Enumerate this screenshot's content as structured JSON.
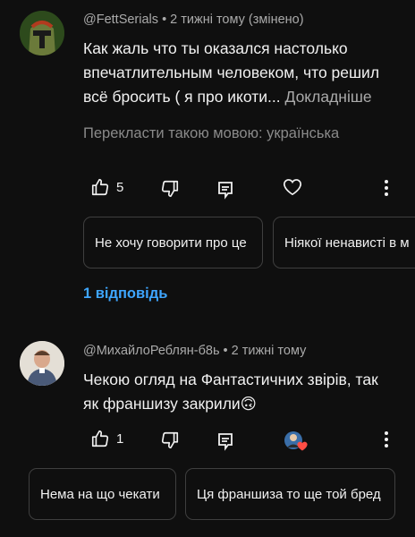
{
  "comments": [
    {
      "author": "@FettSerials",
      "meta": "• 2 тижні тому (змінено)",
      "lines": [
        "Как жаль что ты оказался настолько",
        "впечатлительным человеком, что решил",
        "всё бросить ( я про икоти..."
      ],
      "more": "Докладніше",
      "translate": "Перекласти такою мовою: українська",
      "likes": "5",
      "suggestions": [
        "Не хочу говорити про це",
        "Ніякої ненависті в м"
      ],
      "replies": "1 відповідь"
    },
    {
      "author": "@МихайлоРеблян-б8ь",
      "meta": "• 2 тижні тому",
      "lines": [
        "Чекою огляд на Фантастичних звірів, так",
        "як франшизу закрили🙃"
      ],
      "likes": "1",
      "suggestions": [
        "Нема на що чекати",
        "Ця франшиза то ще той бред"
      ]
    }
  ],
  "icons": {
    "like": "thumb-up-icon",
    "dislike": "thumb-down-icon",
    "reply": "comment-reply-icon",
    "heart": "heart-icon",
    "more": "more-vertical-icon"
  },
  "colors": {
    "background": "#0f0f0f",
    "link": "#3ea6ff",
    "secondary_text": "#aaaaaa",
    "heart": "#ff4e45"
  }
}
